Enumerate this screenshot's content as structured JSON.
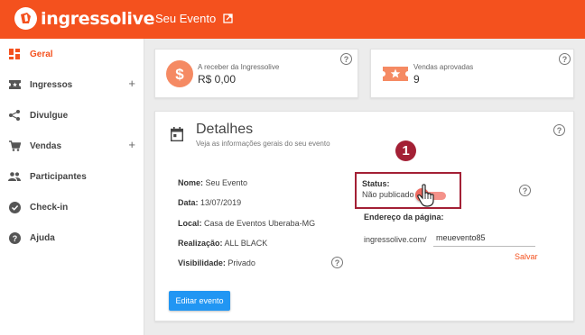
{
  "header": {
    "logo_text": "ingressolive",
    "event_title": "Seu Evento"
  },
  "sidebar": {
    "items": [
      {
        "label": "Geral",
        "icon": "dashboard-icon",
        "active": true,
        "expandable": false
      },
      {
        "label": "Ingressos",
        "icon": "ticket-icon",
        "active": false,
        "expandable": true
      },
      {
        "label": "Divulgue",
        "icon": "share-icon",
        "active": false,
        "expandable": false
      },
      {
        "label": "Vendas",
        "icon": "cart-icon",
        "active": false,
        "expandable": true
      },
      {
        "label": "Participantes",
        "icon": "people-icon",
        "active": false,
        "expandable": false
      },
      {
        "label": "Check-in",
        "icon": "check-circle-icon",
        "active": false,
        "expandable": false
      },
      {
        "label": "Ajuda",
        "icon": "help-circle-icon",
        "active": false,
        "expandable": false
      }
    ],
    "plus_symbol": "+"
  },
  "stats": {
    "receivable": {
      "label": "A receber da Ingressolive",
      "value": "R$ 0,00",
      "icon": "dollar-icon"
    },
    "sales": {
      "label": "Vendas aprovadas",
      "value": "9",
      "icon": "ticket-star-icon"
    }
  },
  "details": {
    "title": "Detalhes",
    "subtitle": "Veja as informações gerais do seu evento",
    "fields": [
      {
        "label": "Nome:",
        "value": "Seu Evento"
      },
      {
        "label": "Data:",
        "value": "13/07/2019"
      },
      {
        "label": "Local:",
        "value": "Casa de Eventos Uberaba-MG"
      },
      {
        "label": "Realização:",
        "value": "ALL BLACK"
      },
      {
        "label": "Visibilidade:",
        "value": "Privado"
      }
    ],
    "status_label": "Status:",
    "status_value": "Não publicado",
    "published": false,
    "badge_number": "1",
    "url_label": "Endereço da página:",
    "url_prefix": "ingressolive.com/",
    "url_slug": "meuevento85",
    "save_label": "Salvar",
    "edit_button": "Editar evento",
    "help_symbol": "?"
  },
  "colors": {
    "brand": "#f4511e",
    "primary_button": "#2196f3",
    "highlight_border": "#a32035",
    "toggle_off": "#ef6a60"
  }
}
